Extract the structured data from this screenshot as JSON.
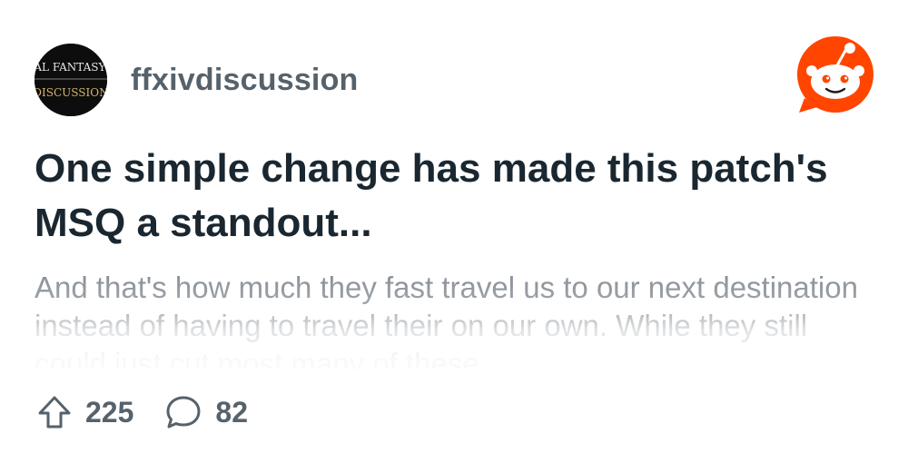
{
  "post": {
    "subreddit": "ffxivdiscussion",
    "avatar_text_top": "FINAL FANTASY XIV",
    "avatar_text_bottom": "DISCUSSION",
    "title": "One simple change has made this patch's MSQ a standout...",
    "body": "And that's how much they fast travel us to our next destination instead of having to travel their on our own. While they still could just cut most many of these...",
    "upvotes": "225",
    "comments": "82"
  },
  "icons": {
    "brand": "reddit-logo-icon",
    "upvote": "upvote-arrow-icon",
    "comment": "comment-bubble-icon"
  },
  "colors": {
    "brand": "#ff4500",
    "title": "#1a2730",
    "meta": "#56626b",
    "body": "#848b92"
  }
}
